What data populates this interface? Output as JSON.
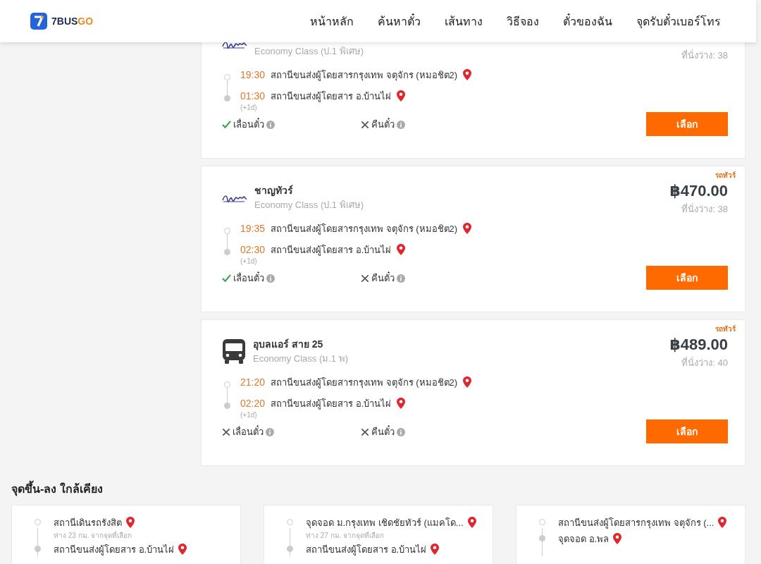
{
  "header": {
    "logo": {
      "part_1": "7BUS",
      "part_2": "GO"
    },
    "nav": [
      {
        "label": "หน้าหลัก"
      },
      {
        "label": "ค้นหาตั๋ว"
      },
      {
        "label": "เส้นทาง"
      },
      {
        "label": "วิธีจอง"
      },
      {
        "label": "ตั๋วของฉัน"
      },
      {
        "label": "จุดรับตั๋วเบอร์โทร"
      }
    ]
  },
  "trips": [
    {
      "kind": "company",
      "class": "Economy Class (ป.1 พิเศษ)",
      "seats": "ที่นั่งว่าง: 38",
      "departure": {
        "time": "19:30",
        "station": "สถานีขนส่งผู้โดยสารกรุงเทพ จตุจักร (หมอชิต2)"
      },
      "arrival": {
        "time": "01:30",
        "station": "สถานีขนส่งผู้โดยสาร อ.บ้านไผ่",
        "day_offset": "(+1d)"
      },
      "reschedule": {
        "label": "เลื่อนตั๋ว",
        "allowed": true
      },
      "refund": {
        "label": "คืนตั๋ว",
        "allowed": false
      },
      "button": "เลือก"
    },
    {
      "kind": "company",
      "tag": "รถทัวร์",
      "company": "ชาญทัวร์",
      "class": "Economy Class (ป.1 พิเศษ)",
      "price": "฿470.00",
      "seats": "ที่นั่งว่าง: 38",
      "departure": {
        "time": "19:35",
        "station": "สถานีขนส่งผู้โดยสารกรุงเทพ จตุจักร (หมอชิต2)"
      },
      "arrival": {
        "time": "02:30",
        "station": "สถานีขนส่งผู้โดยสาร อ.บ้านไผ่",
        "day_offset": "(+1d)"
      },
      "reschedule": {
        "label": "เลื่อนตั๋ว",
        "allowed": true
      },
      "refund": {
        "label": "คืนตั๋ว",
        "allowed": false
      },
      "button": "เลือก"
    },
    {
      "kind": "bus",
      "tag": "รถทัวร์",
      "company": "อุบลแอร์ สาย 25",
      "class": "Economy Class (ม.1 พ)",
      "price": "฿489.00",
      "seats": "ที่นั่งว่าง: 40",
      "departure": {
        "time": "21:20",
        "station": "สถานีขนส่งผู้โดยสารกรุงเทพ จตุจักร (หมอชิต2)"
      },
      "arrival": {
        "time": "02:20",
        "station": "สถานีขนส่งผู้โดยสาร อ.บ้านไผ่",
        "day_offset": "(+1d)"
      },
      "reschedule": {
        "label": "เลื่อนตั๋ว",
        "allowed": false
      },
      "refund": {
        "label": "คืนตั๋ว",
        "allowed": false
      },
      "button": "เลือก"
    }
  ],
  "nearby": {
    "title": "จุดขึ้น-ลง ใกล้เคียง",
    "cards": [
      {
        "stops": [
          {
            "name": "สถานีเดินรถรังสิต",
            "distance": "ห่าง 23 กม. จากจุดที่เลือก"
          },
          {
            "name": "สถานีขนส่งผู้โดยสาร อ.บ้านไผ่"
          }
        ]
      },
      {
        "stops": [
          {
            "name": "จุดจอด ม.กรุงเทพ เชิดชัยทัวร์ (แมคโด...",
            "distance": "ห่าง 27 กม. จากจุดที่เลือก"
          },
          {
            "name": "สถานีขนส่งผู้โดยสาร อ.บ้านไผ่"
          }
        ]
      },
      {
        "stops": [
          {
            "name": "สถานีขนส่งผู้โดยสารกรุงเทพ จตุจักร (..."
          },
          {
            "name": "จุดจอด อ.พล"
          }
        ]
      }
    ]
  }
}
